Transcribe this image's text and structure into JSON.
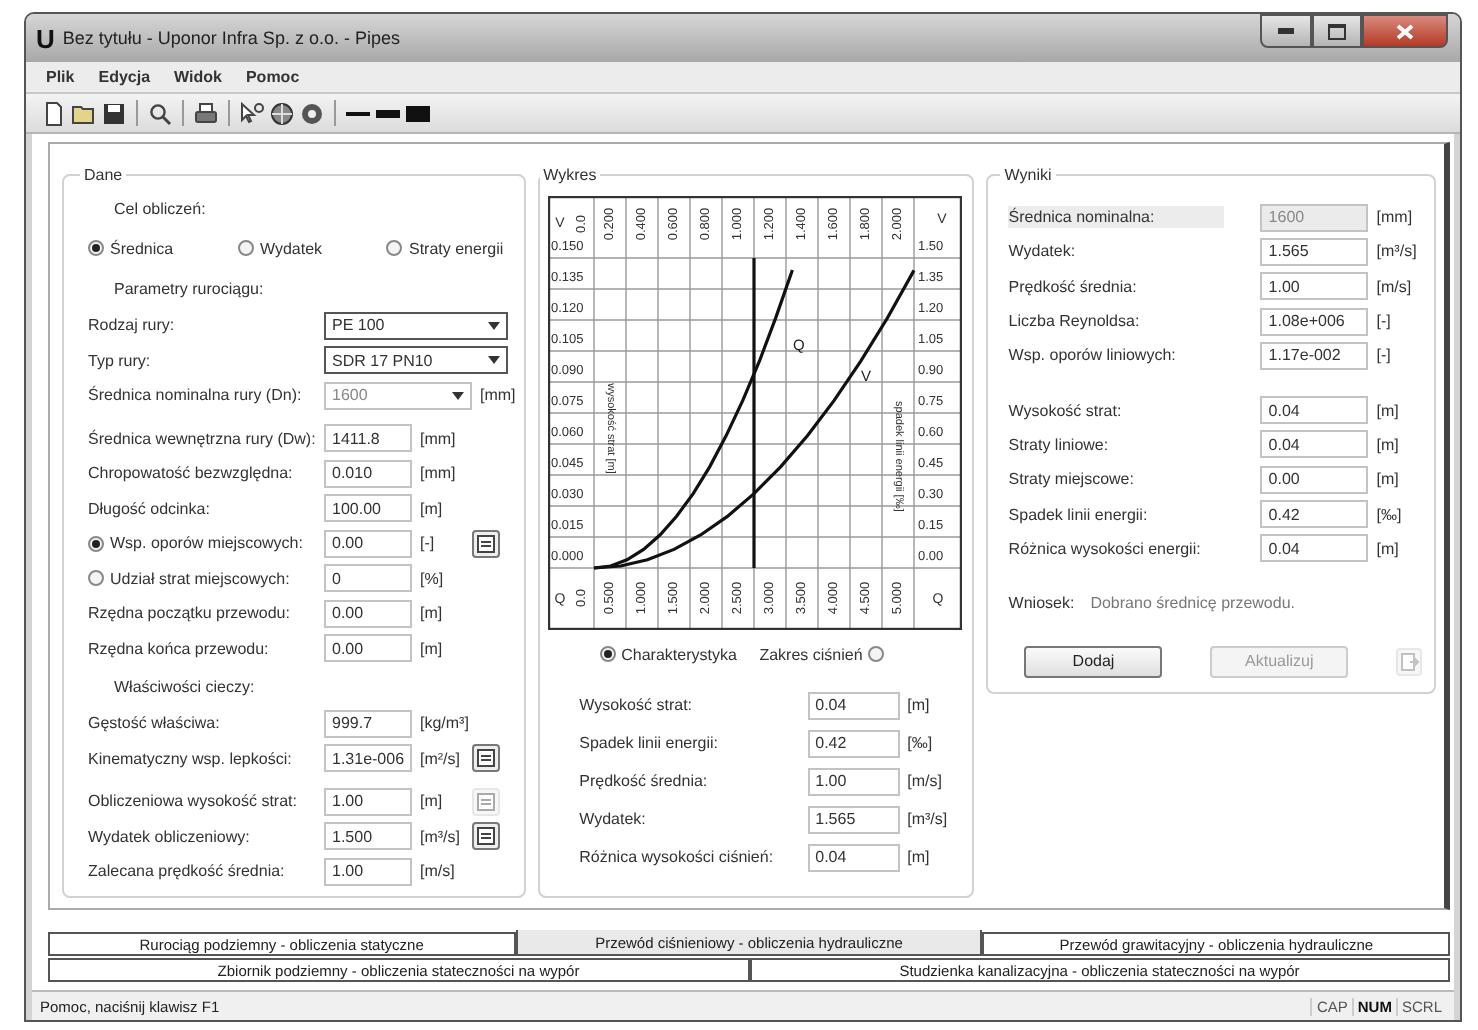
{
  "window": {
    "icon_letter": "U",
    "title": "Bez tytułu - Uponor Infra Sp. z o.o. - Pipes"
  },
  "menu": [
    "Plik",
    "Edycja",
    "Widok",
    "Pomoc"
  ],
  "dane": {
    "title": "Dane",
    "goal_label": "Cel obliczeń:",
    "goal_options": [
      {
        "label": "Średnica",
        "selected": true
      },
      {
        "label": "Wydatek",
        "selected": false
      },
      {
        "label": "Straty energii",
        "selected": false
      }
    ],
    "sections": [
      {
        "heading": "Parametry rurociągu:",
        "rows": [
          {
            "kind": "select",
            "label": "Rodzaj rury:",
            "value": "PE 100"
          },
          {
            "kind": "select",
            "label": "Typ rury:",
            "value": "SDR 17 PN10"
          },
          {
            "kind": "combo",
            "label": "Średnica nominalna rury (Dn):",
            "value": "1600",
            "unit": "[mm]"
          }
        ]
      },
      {
        "rows": [
          {
            "kind": "input",
            "label": "Średnica wewnętrzna rury (Dw):",
            "value": "1411.8",
            "unit": "[mm]"
          },
          {
            "kind": "input",
            "label": "Chropowatość bezwzględna:",
            "value": "0.010",
            "unit": "[mm]"
          },
          {
            "kind": "input",
            "label": "Długość odcinka:",
            "value": "100.00",
            "unit": "[m]"
          },
          {
            "kind": "input",
            "label": "Wsp. oporów miejscowych:",
            "value": "0.00",
            "unit": "[-]",
            "radio": {
              "selected": true
            },
            "button": {
              "disabled": false
            }
          },
          {
            "kind": "input",
            "label": "Udział strat miejscowych:",
            "value": "0",
            "unit": "[%]",
            "radio": {
              "selected": false
            }
          },
          {
            "kind": "input",
            "label": "Rzędna początku przewodu:",
            "value": "0.00",
            "unit": "[m]"
          },
          {
            "kind": "input",
            "label": "Rzędna końca przewodu:",
            "value": "0.00",
            "unit": "[m]"
          }
        ]
      },
      {
        "heading": "Właściwości cieczy:",
        "rows": [
          {
            "kind": "input",
            "label": "Gęstość właściwa:",
            "value": "999.7",
            "unit": "[kg/m³]"
          },
          {
            "kind": "input",
            "label": "Kinematyczny wsp. lepkości:",
            "value": "1.31e-006",
            "unit": "[m²/s]",
            "button": {
              "disabled": false
            }
          }
        ]
      },
      {
        "rows": [
          {
            "kind": "input",
            "label": "Obliczeniowa wysokość strat:",
            "value": "1.00",
            "unit": "[m]",
            "button": {
              "disabled": true
            }
          },
          {
            "kind": "input",
            "label": "Wydatek obliczeniowy:",
            "value": "1.500",
            "unit": "[m³/s]",
            "button": {
              "disabled": false
            }
          },
          {
            "kind": "input",
            "label": "Zalecana prędkość średnia:",
            "value": "1.00",
            "unit": "[m/s]"
          }
        ]
      }
    ]
  },
  "wykres": {
    "title": "Wykres",
    "nomogram": {
      "corner_labels": {
        "top_left": "V",
        "top_right": "V",
        "bottom_left": "Q",
        "bottom_right": "Q"
      },
      "top_ticks": [
        "0.0",
        "0.200",
        "0.400",
        "0.600",
        "0.800",
        "1.000",
        "1.200",
        "1.400",
        "1.600",
        "1.800",
        "2.000"
      ],
      "left_ticks": [
        "0.150",
        "0.135",
        "0.120",
        "0.105",
        "0.090",
        "0.075",
        "0.060",
        "0.045",
        "0.030",
        "0.015",
        "0.000"
      ],
      "right_ticks": [
        "1.50",
        "1.35",
        "1.20",
        "1.05",
        "0.90",
        "0.75",
        "0.60",
        "0.45",
        "0.30",
        "0.15",
        "0.00"
      ],
      "bottom_ticks": [
        "0.0",
        "0.500",
        "1.000",
        "1.500",
        "2.000",
        "2.500",
        "3.000",
        "3.500",
        "4.000",
        "4.500",
        "5.000"
      ],
      "left_title": "wysokość strat [m]",
      "right_title": "spadek linii energii [‰]",
      "curve_labels": [
        "Q",
        "V"
      ]
    },
    "modes": [
      {
        "label": "Charakterystyka",
        "selected": true
      },
      {
        "label": "Zakres ciśnień",
        "selected": false
      }
    ],
    "rows": [
      {
        "label": "Wysokość strat:",
        "value": "0.04",
        "unit": "[m]"
      },
      {
        "label": "Spadek linii energii:",
        "value": "0.42",
        "unit": "[‰]"
      },
      {
        "label": "Prędkość średnia:",
        "value": "1.00",
        "unit": "[m/s]"
      },
      {
        "label": "Wydatek:",
        "value": "1.565",
        "unit": "[m³/s]"
      },
      {
        "label": "Różnica wysokości ciśnień:",
        "value": "0.04",
        "unit": "[m]"
      }
    ]
  },
  "wyniki": {
    "title": "Wyniki",
    "groups": [
      [
        {
          "kind": "readonly",
          "label": "Średnica nominalna:",
          "value": "1600",
          "unit": "[mm]"
        },
        {
          "kind": "input",
          "label": "Wydatek:",
          "value": "1.565",
          "unit": "[m³/s]"
        },
        {
          "kind": "input",
          "label": "Prędkość średnia:",
          "value": "1.00",
          "unit": "[m/s]"
        },
        {
          "kind": "input",
          "label": "Liczba Reynoldsa:",
          "value": "1.08e+006",
          "unit": "[-]"
        },
        {
          "kind": "input",
          "label": "Wsp. oporów liniowych:",
          "value": "1.17e-002",
          "unit": "[-]"
        }
      ],
      [
        {
          "kind": "input",
          "label": "Wysokość strat:",
          "value": "0.04",
          "unit": "[m]"
        },
        {
          "kind": "input",
          "label": "Straty liniowe:",
          "value": "0.04",
          "unit": "[m]"
        },
        {
          "kind": "input",
          "label": "Straty miejscowe:",
          "value": "0.00",
          "unit": "[m]"
        },
        {
          "kind": "input",
          "label": "Spadek linii energii:",
          "value": "0.42",
          "unit": "[‰]"
        },
        {
          "kind": "input",
          "label": "Różnica wysokości energii:",
          "value": "0.04",
          "unit": "[m]"
        }
      ]
    ],
    "conclusion_label": "Wniosek:",
    "conclusion": "Dobrano średnicę przewodu.",
    "buttons": [
      {
        "label": "Dodaj",
        "disabled": false
      },
      {
        "label": "Aktualizuj",
        "disabled": true
      }
    ]
  },
  "tabs": [
    [
      {
        "label": "Rurociąg podziemny - obliczenia statyczne",
        "selected": false
      },
      {
        "label": "Przewód ciśnieniowy - obliczenia hydrauliczne",
        "selected": true
      },
      {
        "label": "Przewód grawitacyjny - obliczenia hydrauliczne",
        "selected": false
      }
    ],
    [
      {
        "label": "Zbiornik podziemny - obliczenia stateczności na wypór",
        "selected": false
      },
      {
        "label": "Studzienka kanalizacyjna - obliczenia stateczności na wypór",
        "selected": false
      }
    ]
  ],
  "status_bar": {
    "text": "Pomoc, naciśnij klawisz F1",
    "indicators": [
      {
        "label": "CAP",
        "on": false
      },
      {
        "label": "NUM",
        "on": true
      },
      {
        "label": "SCRL",
        "on": false
      }
    ]
  }
}
